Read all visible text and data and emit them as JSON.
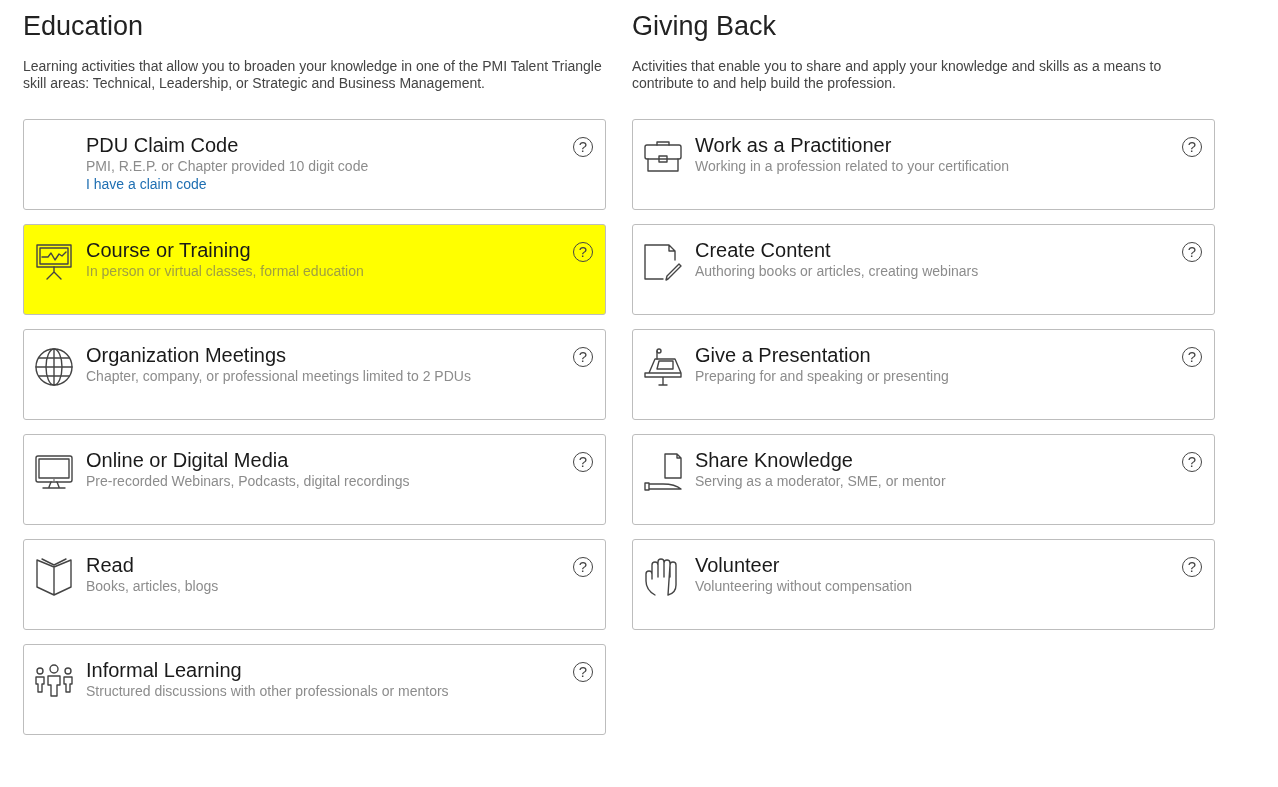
{
  "sections": [
    {
      "title": "Education",
      "description": "Learning activities that allow you to broaden your knowledge in one of the PMI Talent Triangle skill areas: Technical, Leadership, or Strategic and Business Management.",
      "cards": [
        {
          "title": "PDU Claim Code",
          "subtitle": "PMI, R.E.P. or Chapter provided 10 digit code",
          "link": "I have a claim code",
          "help": "?",
          "highlighted": false
        },
        {
          "title": "Course or Training",
          "subtitle": "In person or virtual classes, formal education",
          "help": "?",
          "highlighted": true
        },
        {
          "title": "Organization Meetings",
          "subtitle": "Chapter, company, or professional meetings limited to 2 PDUs",
          "help": "?",
          "highlighted": false
        },
        {
          "title": "Online or Digital Media",
          "subtitle": "Pre-recorded Webinars, Podcasts, digital recordings",
          "help": "?",
          "highlighted": false
        },
        {
          "title": "Read",
          "subtitle": "Books, articles, blogs",
          "help": "?",
          "highlighted": false
        },
        {
          "title": "Informal Learning",
          "subtitle": "Structured discussions with other professionals or mentors",
          "help": "?",
          "highlighted": false
        }
      ]
    },
    {
      "title": "Giving Back",
      "description": "Activities that enable you to share and apply your knowledge and skills as a means to contribute to and help build the profession.",
      "cards": [
        {
          "title": "Work as a Practitioner",
          "subtitle": "Working in a profession related to your certification",
          "help": "?",
          "highlighted": false
        },
        {
          "title": "Create Content",
          "subtitle": "Authoring books or articles, creating webinars",
          "help": "?",
          "highlighted": false
        },
        {
          "title": "Give a Presentation",
          "subtitle": "Preparing for and speaking or presenting",
          "help": "?",
          "highlighted": false
        },
        {
          "title": "Share Knowledge",
          "subtitle": "Serving as a moderator, SME, or mentor",
          "help": "?",
          "highlighted": false
        },
        {
          "title": "Volunteer",
          "subtitle": "Volunteering without compensation",
          "help": "?",
          "highlighted": false
        }
      ]
    }
  ]
}
